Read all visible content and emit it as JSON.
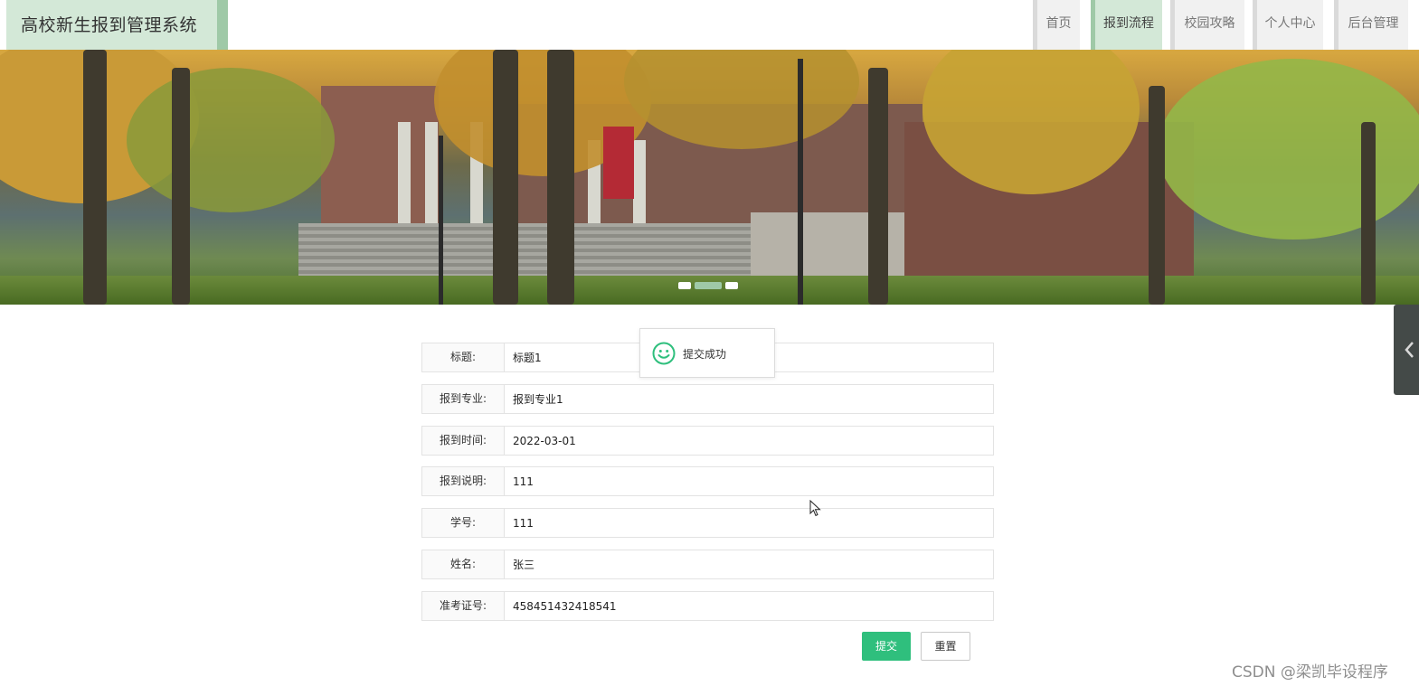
{
  "header": {
    "title": "高校新生报到管理系统",
    "nav": [
      {
        "label": "首页",
        "active": false
      },
      {
        "label": "报到流程",
        "active": true
      },
      {
        "label": "校园攻略",
        "active": false
      },
      {
        "label": "个人中心",
        "active": false
      },
      {
        "label": "后台管理",
        "active": false
      }
    ]
  },
  "banner": {
    "icon": "campus-photo",
    "slides": 3,
    "active_slide": 2
  },
  "form": {
    "fields": [
      {
        "label": "标题:",
        "value": "标题1"
      },
      {
        "label": "报到专业:",
        "value": "报到专业1"
      },
      {
        "label": "报到时间:",
        "value": "2022-03-01"
      },
      {
        "label": "报到说明:",
        "value": "111"
      },
      {
        "label": "学号:",
        "value": "111"
      },
      {
        "label": "姓名:",
        "value": "张三"
      },
      {
        "label": "准考证号:",
        "value": "458451432418541"
      }
    ],
    "submit_label": "提交",
    "reset_label": "重置"
  },
  "toast": {
    "icon": "smiley-icon",
    "message": "提交成功"
  },
  "watermark": "CSDN @梁凯毕设程序",
  "colors": {
    "accent": "#2fbf7d",
    "brand_bg": "#d3e8d7",
    "brand_border": "#9fc9a7",
    "nav_bg": "#f1f1f1"
  }
}
